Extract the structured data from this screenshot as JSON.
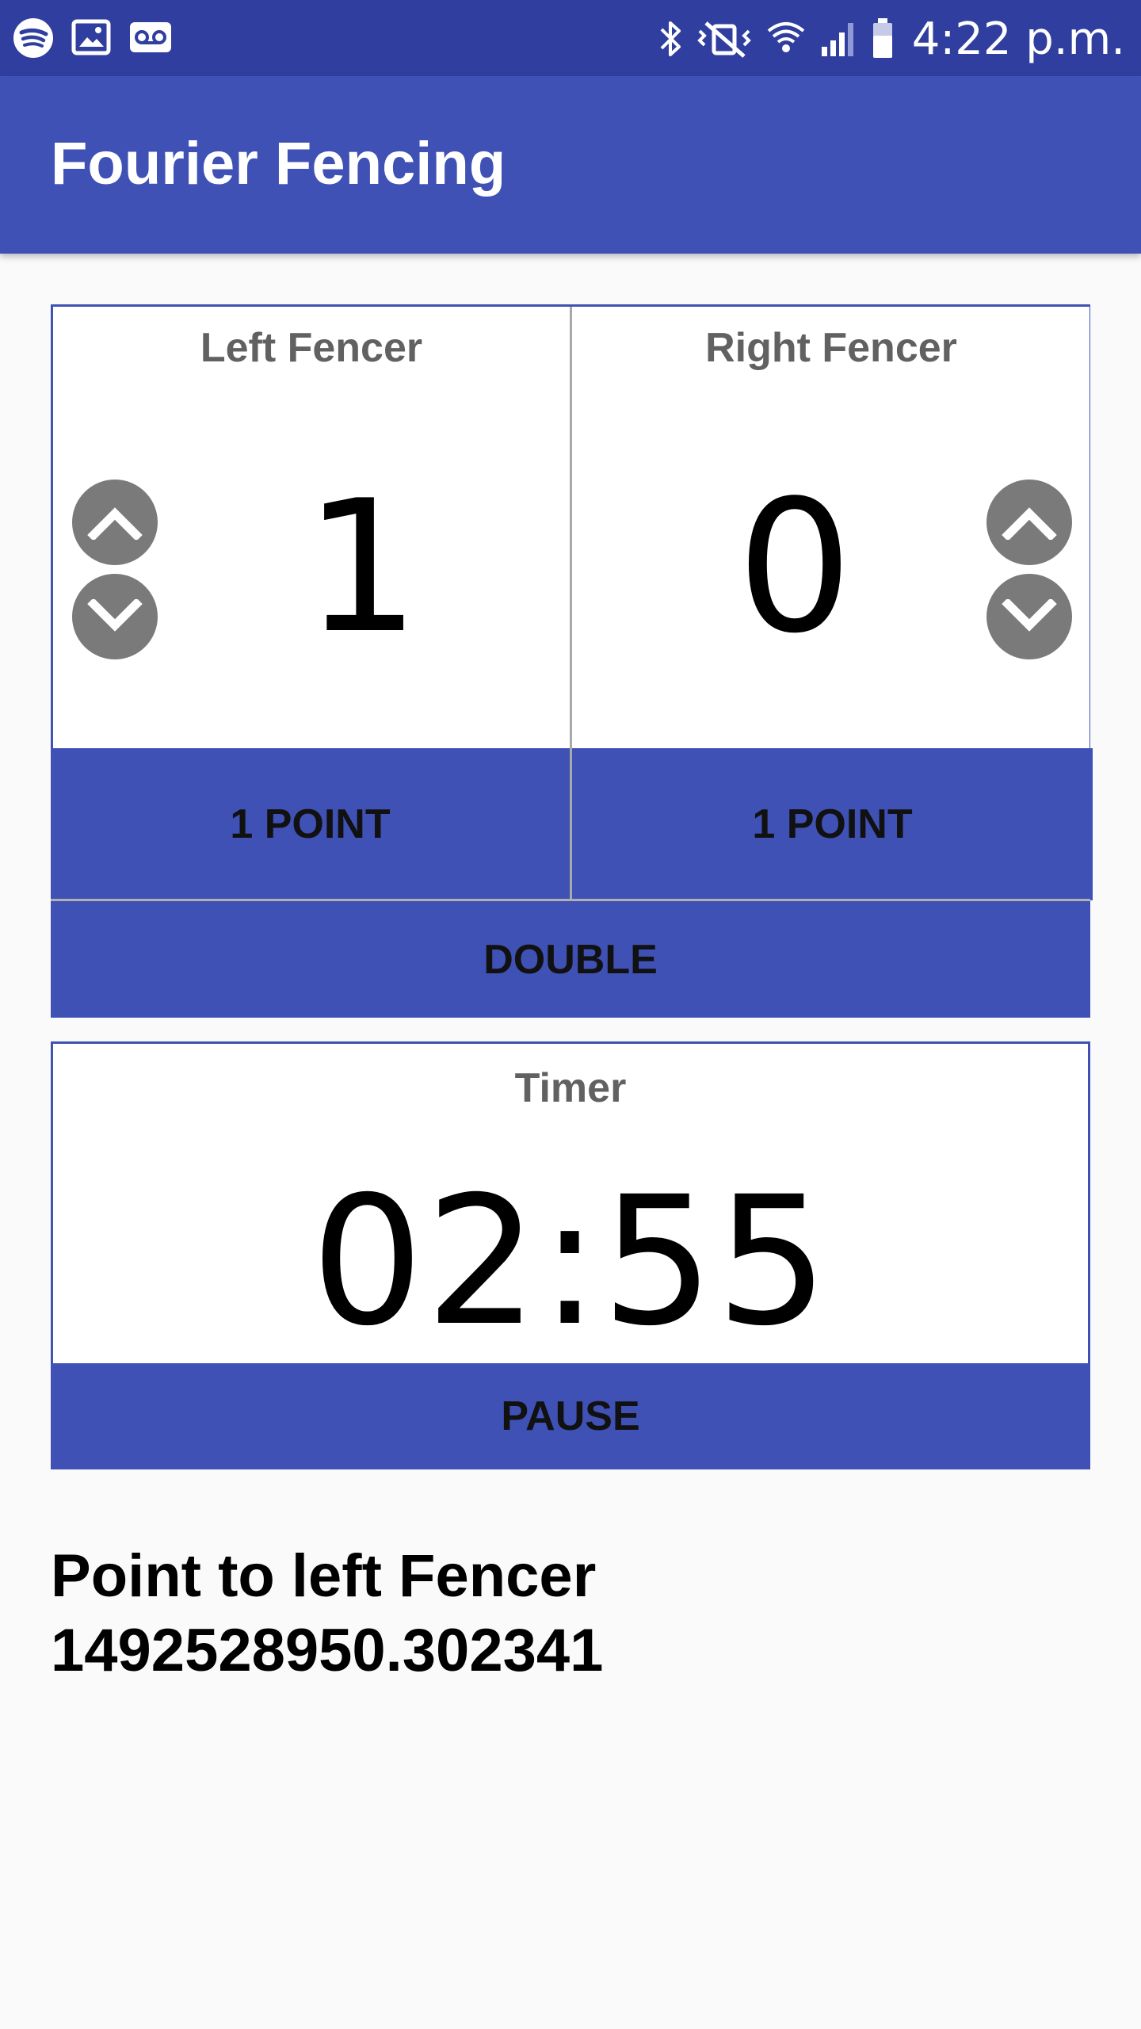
{
  "status_bar": {
    "left_icons": [
      "spotify-icon",
      "gallery-icon",
      "voicemail-icon"
    ],
    "right_icons": [
      "bluetooth-icon",
      "vibrate-mute-icon",
      "wifi-icon",
      "signal-icon",
      "battery-icon"
    ],
    "time": "4:22 p.m."
  },
  "app_bar": {
    "title": "Fourier Fencing"
  },
  "colors": {
    "status_bar": "#303f9f",
    "primary": "#3f51b5",
    "background": "#fafafa",
    "round_button": "#7a7a7a"
  },
  "score": {
    "left": {
      "label": "Left Fencer",
      "value": "1",
      "point_button": "1 POINT",
      "up_icon": "chevron-up-icon",
      "down_icon": "chevron-down-icon"
    },
    "right": {
      "label": "Right Fencer",
      "value": "0",
      "point_button": "1 POINT",
      "up_icon": "chevron-up-icon",
      "down_icon": "chevron-down-icon"
    },
    "double_button": "DOUBLE"
  },
  "timer": {
    "label": "Timer",
    "value": "02:55",
    "pause_button": "PAUSE"
  },
  "message": {
    "line1": "Point to left Fencer",
    "line2": "1492528950.302341"
  }
}
